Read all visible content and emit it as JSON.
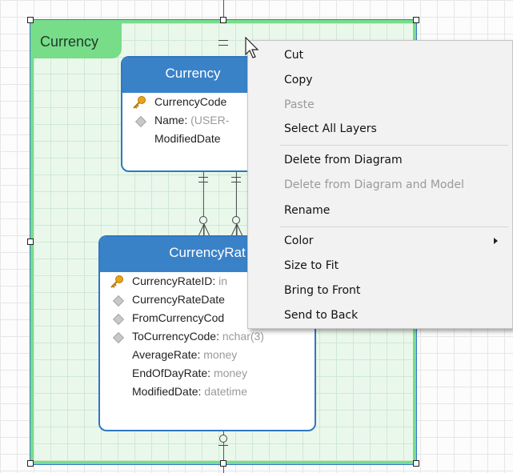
{
  "layer": {
    "title": "Currency",
    "fill_color": "#eaf8ec",
    "border_color": "#77dd88"
  },
  "tables": [
    {
      "name": "Currency",
      "header_color": "#3a82c8",
      "fields": [
        {
          "name": "CurrencyCode",
          "type": "",
          "sep": "",
          "icon": "key-icon"
        },
        {
          "name": "Name",
          "type": " (USER-",
          "sep": ":",
          "icon": "diamond-icon"
        },
        {
          "name": "ModifiedDate",
          "type": "",
          "sep": "",
          "icon": ""
        }
      ]
    },
    {
      "name": "CurrencyRat",
      "header_color": "#3a82c8",
      "fields": [
        {
          "name": "CurrencyRateID",
          "type": " in",
          "sep": ":",
          "icon": "key-icon"
        },
        {
          "name": "CurrencyRateDate",
          "type": "",
          "sep": "",
          "icon": "diamond-icon"
        },
        {
          "name": "FromCurrencyCod",
          "type": "",
          "sep": "",
          "icon": "diamond-icon"
        },
        {
          "name": "ToCurrencyCode",
          "type": " nchar(3)",
          "sep": ":",
          "icon": "diamond-icon"
        },
        {
          "name": "AverageRate",
          "type": " money",
          "sep": ":",
          "icon": ""
        },
        {
          "name": "EndOfDayRate",
          "type": " money",
          "sep": ":",
          "icon": ""
        },
        {
          "name": "ModifiedDate",
          "type": " datetime",
          "sep": ":",
          "icon": ""
        }
      ]
    }
  ],
  "context_menu": {
    "items": [
      {
        "label": "Cut",
        "enabled": true
      },
      {
        "label": "Copy",
        "enabled": true
      },
      {
        "label": "Paste",
        "enabled": false
      },
      {
        "label": "Select All Layers",
        "enabled": true
      },
      {
        "separator": true
      },
      {
        "label": "Delete from Diagram",
        "enabled": true
      },
      {
        "label": "Delete from Diagram and Model",
        "enabled": false
      },
      {
        "label": "Rename",
        "enabled": true
      },
      {
        "separator": true
      },
      {
        "label": "Color",
        "enabled": true,
        "submenu": true
      },
      {
        "label": "Size to Fit",
        "enabled": true
      },
      {
        "label": "Bring to Front",
        "enabled": true
      },
      {
        "label": "Send to Back",
        "enabled": true
      }
    ]
  },
  "icons": {
    "key": "key-icon",
    "diamond": "diamond-icon",
    "cursor": "mouse-pointer-icon",
    "submenu_arrow": "chevron-right-icon"
  }
}
